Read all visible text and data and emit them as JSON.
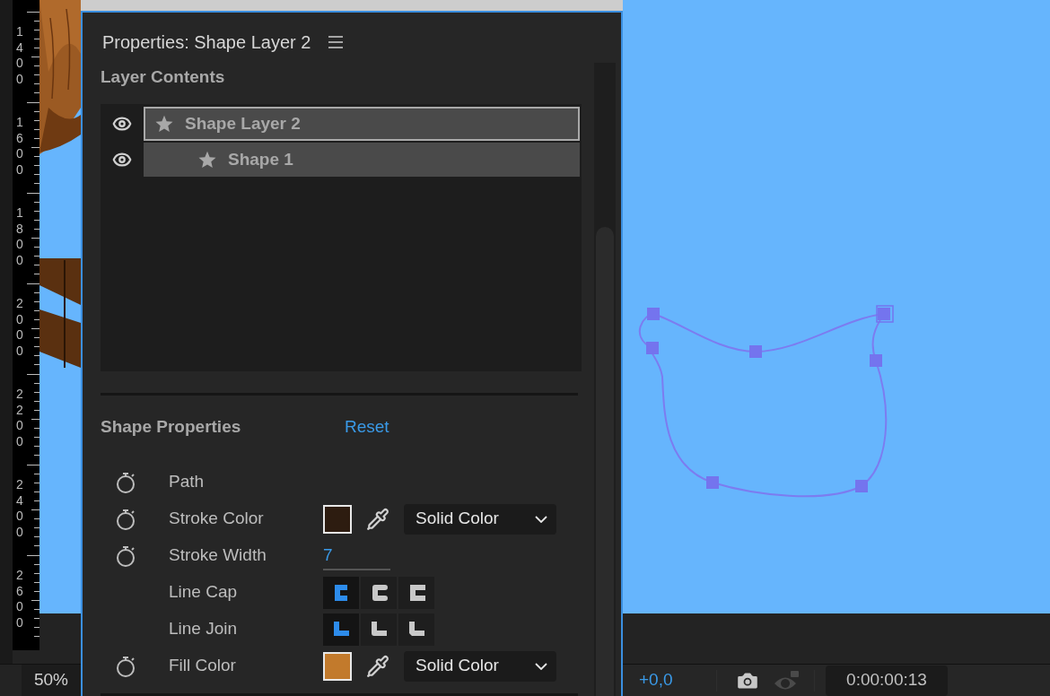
{
  "ruler": {
    "labels": [
      "1400",
      "1600",
      "1800",
      "2000",
      "2200",
      "2400",
      "2600"
    ]
  },
  "panel": {
    "title": "Properties: Shape Layer 2",
    "layer_contents": {
      "title": "Layer Contents",
      "layers": [
        {
          "name": "Shape Layer 2",
          "visible": true,
          "selected": true,
          "children": [
            {
              "name": "Shape 1",
              "visible": true,
              "selected": false
            }
          ]
        }
      ]
    },
    "shape_properties": {
      "title": "Shape Properties",
      "reset": "Reset",
      "rows": [
        {
          "kind": "label",
          "label": "Path",
          "stopwatch": true
        },
        {
          "kind": "color",
          "label": "Stroke Color",
          "stopwatch": true,
          "color": "#2d1c10",
          "mode": "Solid Color"
        },
        {
          "kind": "number",
          "label": "Stroke Width",
          "stopwatch": true,
          "value": "7"
        },
        {
          "kind": "segmented",
          "label": "Line Cap",
          "stopwatch": false,
          "options": [
            {
              "kind": "butt",
              "selected": true
            },
            {
              "kind": "round",
              "selected": false
            },
            {
              "kind": "projecting",
              "selected": false
            }
          ]
        },
        {
          "kind": "segmented",
          "label": "Line Join",
          "stopwatch": false,
          "options": [
            {
              "kind": "miter",
              "selected": true
            },
            {
              "kind": "round_join",
              "selected": false
            },
            {
              "kind": "bevel",
              "selected": false
            }
          ]
        },
        {
          "kind": "color",
          "label": "Fill Color",
          "stopwatch": true,
          "color": "#c27a2c",
          "mode": "Solid Color"
        }
      ]
    }
  },
  "status_bar": {
    "zoom": "50%",
    "exposure": "+0,0",
    "show_snapshot": {
      "disabled": true
    },
    "timecode": "0:00:00:13"
  }
}
